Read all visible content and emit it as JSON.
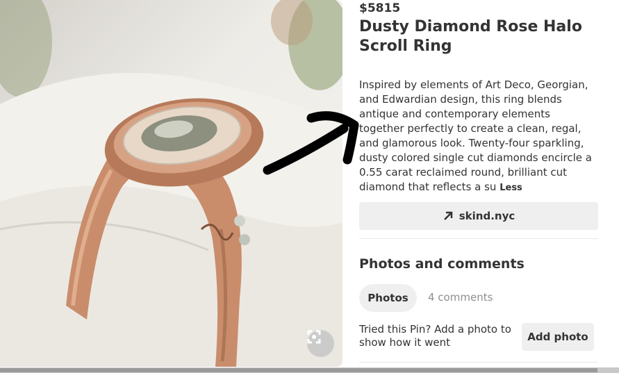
{
  "pin": {
    "price": "$5815",
    "title": "Dusty Diamond Rose Halo Scroll Ring",
    "description": "Inspired by elements of Art Deco, Georgian, and Edwardian design, this ring blends antique and contemporary elements together perfectly to create a clean, regal, and glamorous look. Twenty-four sparkling, dusty colored single cut diamonds encircle a 0.55 carat reclaimed round, brilliant cut diamond that reflects a su",
    "less_label": "Less",
    "link_label": "skind.nyc",
    "link_icon": "arrow-up-right-icon"
  },
  "comments": {
    "section_title": "Photos and comments",
    "tabs": [
      {
        "label": "Photos",
        "active": true
      },
      {
        "label": "4 comments",
        "active": false
      }
    ],
    "prompt": "Tried this Pin? Add a photo to show how it went",
    "add_photo_label": "Add photo"
  },
  "image": {
    "subject": "rose-gold-halo-ring",
    "expand_icon": "expand-icon"
  },
  "colors": {
    "text": "#333333",
    "muted": "#8e8e8e",
    "button_bg": "#efefef",
    "rose_gold": "#c98d6c"
  }
}
